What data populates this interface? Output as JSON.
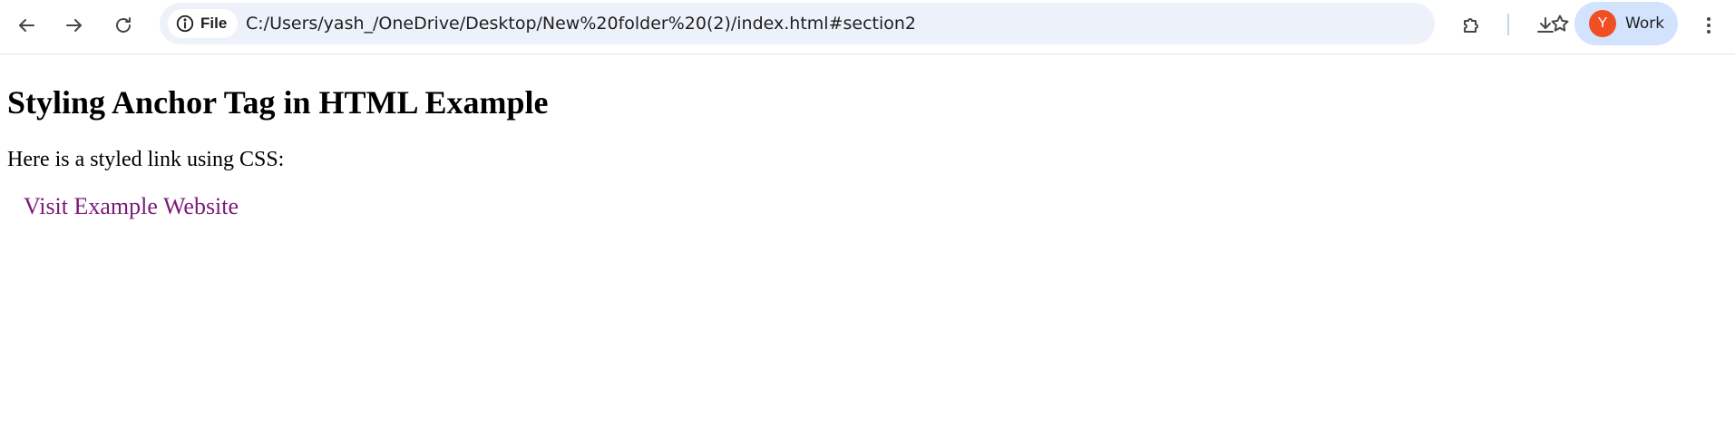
{
  "browser": {
    "site_chip_label": "File",
    "url": "C:/Users/yash_/OneDrive/Desktop/New%20folder%20(2)/index.html#section2",
    "profile": {
      "initial": "Y",
      "name": "Work"
    },
    "icons": {
      "back": "arrow-left-icon",
      "forward": "arrow-right-icon",
      "reload": "reload-icon",
      "info": "info-icon",
      "bookmark": "star-icon",
      "extensions": "puzzle-icon",
      "downloads": "download-icon",
      "menu": "kebab-menu-icon"
    },
    "colors": {
      "omnibox_bg": "#edf2fa",
      "profile_bg": "#d3e3fd",
      "avatar_bg": "#f04e23"
    }
  },
  "page": {
    "heading": "Styling Anchor Tag in HTML Example",
    "intro": "Here is a styled link using CSS:",
    "link_text": "Visit Example Website",
    "link_color": "#7a1a7a"
  }
}
